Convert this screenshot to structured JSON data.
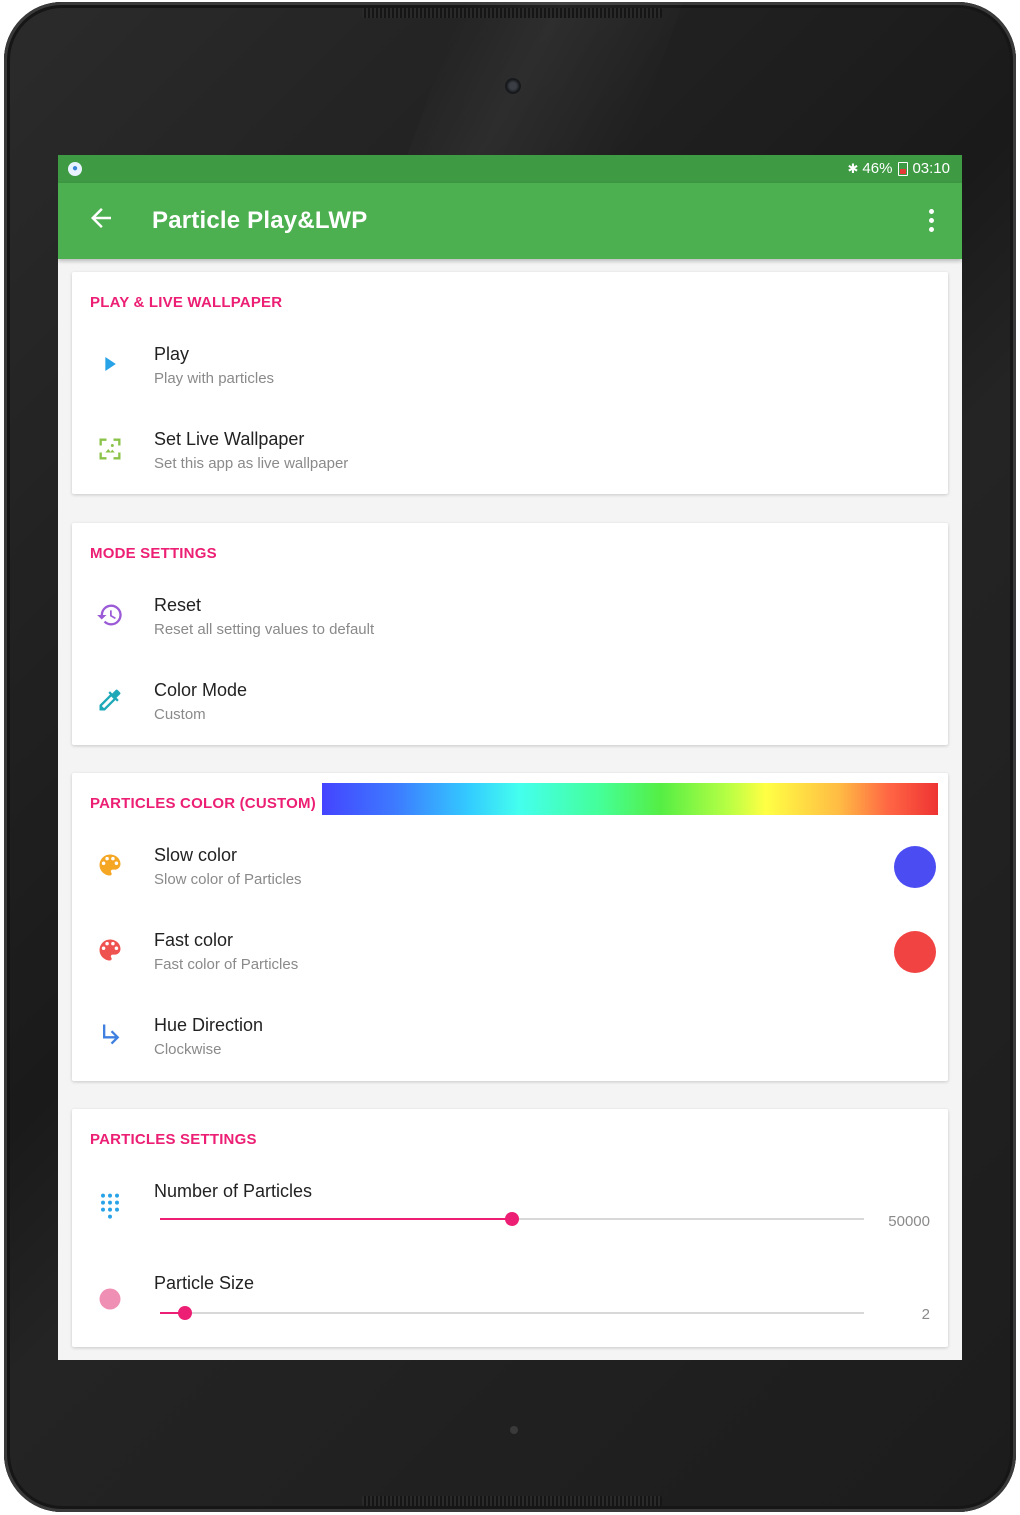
{
  "statusbar": {
    "battery": "46%",
    "time": "03:10"
  },
  "appbar": {
    "title": "Particle Play&LWP"
  },
  "sections": {
    "play": {
      "title": "PLAY & LIVE WALLPAPER",
      "items": [
        {
          "title": "Play",
          "subtitle": "Play with particles",
          "icon": "play-icon"
        },
        {
          "title": "Set Live Wallpaper",
          "subtitle": "Set this app as live wallpaper",
          "icon": "wallpaper-icon"
        }
      ]
    },
    "mode": {
      "title": "MODE SETTINGS",
      "items": [
        {
          "title": "Reset",
          "subtitle": "Reset all setting values to default",
          "icon": "history-icon"
        },
        {
          "title": "Color Mode",
          "subtitle": "Custom",
          "icon": "eyedropper-icon"
        }
      ]
    },
    "color": {
      "title": "PARTICLES COLOR (CUSTOM)",
      "items": [
        {
          "title": "Slow color",
          "subtitle": "Slow color of Particles",
          "icon": "palette-icon",
          "swatch": "#4b4df2"
        },
        {
          "title": "Fast color",
          "subtitle": "Fast color of Particles",
          "icon": "palette-icon",
          "swatch": "#f24343"
        },
        {
          "title": "Hue Direction",
          "subtitle": "Clockwise",
          "icon": "turn-right-arrow-icon"
        }
      ]
    },
    "particles": {
      "title": "PARTICLES SETTINGS",
      "items": [
        {
          "title": "Number of Particles",
          "value": "50000",
          "fraction": 0.5,
          "icon": "dialpad-icon"
        },
        {
          "title": "Particle Size",
          "value": "2",
          "fraction": 0.035,
          "icon": "dot-icon"
        }
      ]
    }
  },
  "colors": {
    "primary": "#4caf50",
    "primary_dark": "#3f9a44",
    "accent": "#ec1f74"
  }
}
